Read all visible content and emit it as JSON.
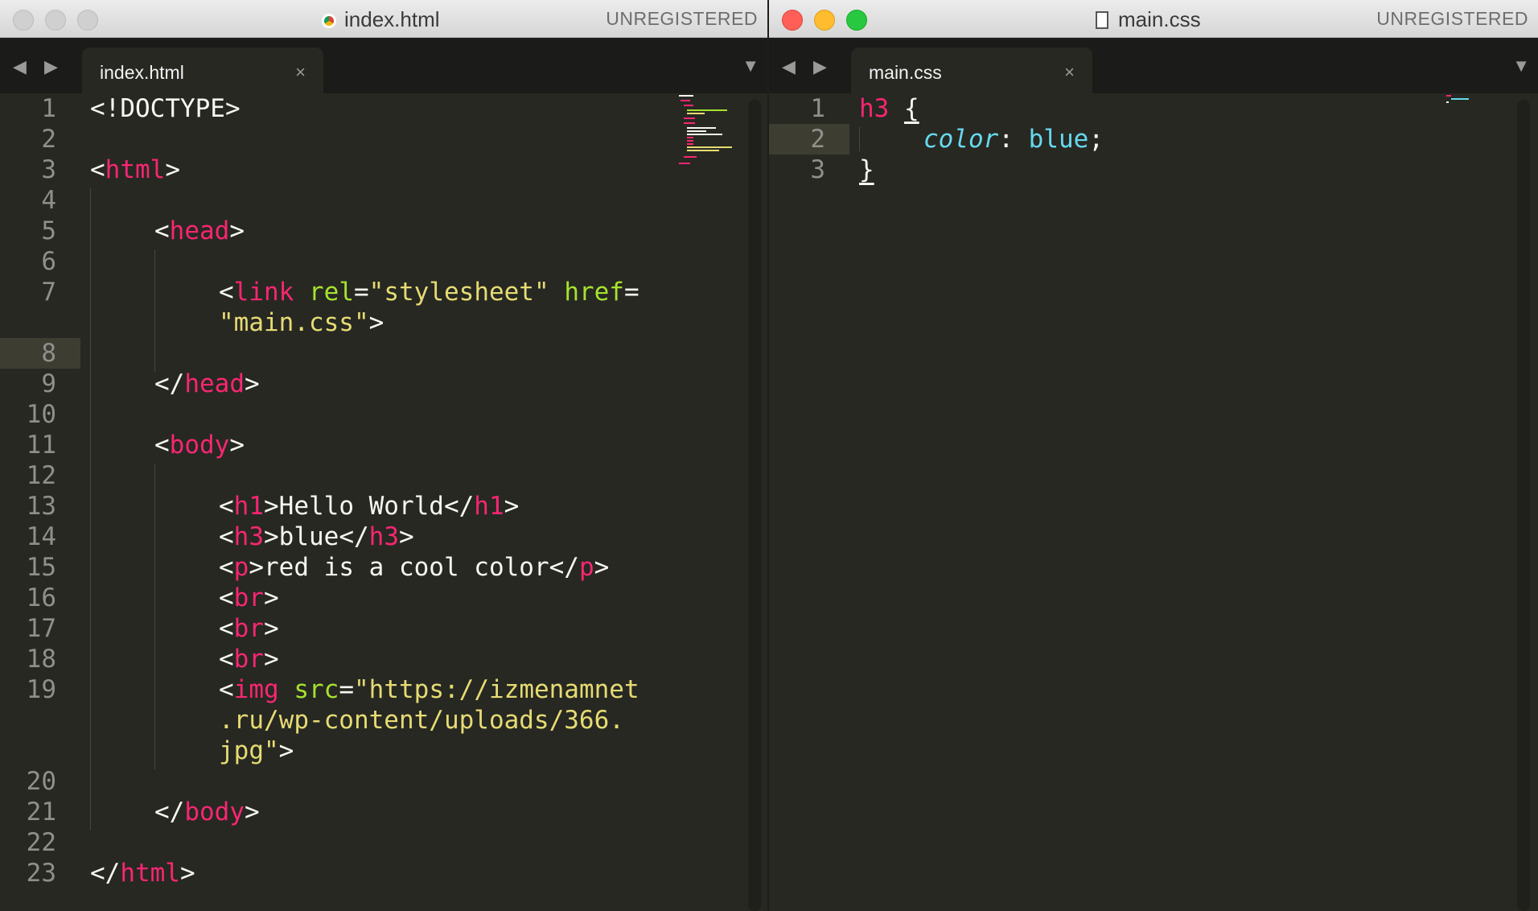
{
  "left_window": {
    "title": "index.html",
    "unregistered": "UNREGISTERED",
    "tab_label": "index.html",
    "tab_close": "×",
    "nav_arrows": "◀ ▶",
    "tab_menu": "▼",
    "highlighted_line": 8,
    "lines": [
      {
        "n": "1",
        "y": 0,
        "segs": [
          [
            "p",
            "<!DOCTYPE>"
          ]
        ]
      },
      {
        "n": "2",
        "y": 1,
        "segs": []
      },
      {
        "n": "3",
        "y": 2,
        "segs": [
          [
            "p",
            "<"
          ],
          [
            "t",
            "html"
          ],
          [
            "p",
            ">"
          ]
        ]
      },
      {
        "n": "4",
        "y": 3,
        "segs": []
      },
      {
        "n": "5",
        "y": 4,
        "indent": 1,
        "segs": [
          [
            "p",
            "<"
          ],
          [
            "t",
            "head"
          ],
          [
            "p",
            ">"
          ]
        ]
      },
      {
        "n": "6",
        "y": 5,
        "segs": []
      },
      {
        "n": "7",
        "y": 6,
        "indent": 2,
        "segs": [
          [
            "p",
            "<"
          ],
          [
            "t",
            "link"
          ],
          [
            "p",
            " "
          ],
          [
            "a",
            "rel"
          ],
          [
            "p",
            "="
          ],
          [
            "s",
            "\"stylesheet\""
          ],
          [
            "p",
            " "
          ],
          [
            "a",
            "href"
          ],
          [
            "p",
            "="
          ]
        ]
      },
      {
        "n": "",
        "y": 7,
        "indent": 2,
        "segs": [
          [
            "s",
            "\"main.css\""
          ],
          [
            "p",
            ">"
          ]
        ]
      },
      {
        "n": "8",
        "y": 8,
        "segs": []
      },
      {
        "n": "9",
        "y": 9,
        "indent": 1,
        "segs": [
          [
            "p",
            "</"
          ],
          [
            "t",
            "head"
          ],
          [
            "p",
            ">"
          ]
        ]
      },
      {
        "n": "10",
        "y": 10,
        "segs": []
      },
      {
        "n": "11",
        "y": 11,
        "indent": 1,
        "segs": [
          [
            "p",
            "<"
          ],
          [
            "t",
            "body"
          ],
          [
            "p",
            ">"
          ]
        ]
      },
      {
        "n": "12",
        "y": 12,
        "segs": []
      },
      {
        "n": "13",
        "y": 13,
        "indent": 2,
        "segs": [
          [
            "p",
            "<"
          ],
          [
            "t",
            "h1"
          ],
          [
            "p",
            ">Hello World</"
          ],
          [
            "t",
            "h1"
          ],
          [
            "p",
            ">"
          ]
        ]
      },
      {
        "n": "14",
        "y": 14,
        "indent": 2,
        "segs": [
          [
            "p",
            "<"
          ],
          [
            "t",
            "h3"
          ],
          [
            "p",
            ">blue</"
          ],
          [
            "t",
            "h3"
          ],
          [
            "p",
            ">"
          ]
        ]
      },
      {
        "n": "15",
        "y": 15,
        "indent": 2,
        "segs": [
          [
            "p",
            "<"
          ],
          [
            "t",
            "p"
          ],
          [
            "p",
            ">red is a cool color</"
          ],
          [
            "t",
            "p"
          ],
          [
            "p",
            ">"
          ]
        ]
      },
      {
        "n": "16",
        "y": 16,
        "indent": 2,
        "segs": [
          [
            "p",
            "<"
          ],
          [
            "t",
            "br"
          ],
          [
            "p",
            ">"
          ]
        ]
      },
      {
        "n": "17",
        "y": 17,
        "indent": 2,
        "segs": [
          [
            "p",
            "<"
          ],
          [
            "t",
            "br"
          ],
          [
            "p",
            ">"
          ]
        ]
      },
      {
        "n": "18",
        "y": 18,
        "indent": 2,
        "segs": [
          [
            "p",
            "<"
          ],
          [
            "t",
            "br"
          ],
          [
            "p",
            ">"
          ]
        ]
      },
      {
        "n": "19",
        "y": 19,
        "indent": 2,
        "segs": [
          [
            "p",
            "<"
          ],
          [
            "t",
            "img"
          ],
          [
            "p",
            " "
          ],
          [
            "a",
            "src"
          ],
          [
            "p",
            "="
          ],
          [
            "s",
            "\"https://izmenamnet"
          ]
        ]
      },
      {
        "n": "",
        "y": 20,
        "indent": 2,
        "segs": [
          [
            "s",
            ".ru/wp-content/uploads/366."
          ]
        ]
      },
      {
        "n": "",
        "y": 21,
        "indent": 2,
        "segs": [
          [
            "s",
            "jpg\""
          ],
          [
            "p",
            ">"
          ]
        ]
      },
      {
        "n": "20",
        "y": 22,
        "segs": []
      },
      {
        "n": "21",
        "y": 23,
        "indent": 1,
        "segs": [
          [
            "p",
            "</"
          ],
          [
            "t",
            "body"
          ],
          [
            "p",
            ">"
          ]
        ]
      },
      {
        "n": "22",
        "y": 24,
        "segs": []
      },
      {
        "n": "23",
        "y": 25,
        "segs": [
          [
            "p",
            "</"
          ],
          [
            "t",
            "html"
          ],
          [
            "p",
            ">"
          ]
        ]
      }
    ]
  },
  "right_window": {
    "title": "main.css",
    "unregistered": "UNREGISTERED",
    "tab_label": "main.css",
    "tab_close": "×",
    "nav_arrows": "◀ ▶",
    "tab_menu": "▼",
    "highlighted_line": 2,
    "lines": [
      {
        "n": "1",
        "y": 0,
        "segs": [
          [
            "t",
            "h3"
          ],
          [
            "p",
            " "
          ],
          [
            "b",
            "{"
          ]
        ]
      },
      {
        "n": "2",
        "y": 1,
        "indent": 1,
        "segs": [
          [
            "k",
            "color"
          ],
          [
            "p",
            ": "
          ],
          [
            "v",
            "blue"
          ],
          [
            "p",
            ";"
          ]
        ]
      },
      {
        "n": "3",
        "y": 2,
        "segs": [
          [
            "b",
            "}"
          ]
        ]
      }
    ]
  },
  "colors": {
    "editor_bg": "#272822",
    "tag": "#f92672",
    "attribute": "#a6e22e",
    "string": "#e6db74",
    "plain": "#f8f8f2",
    "keyword": "#66d9ef",
    "line_number": "#8f908a",
    "line_highlight": "#3e3d32",
    "traffic_red": "#ff5f57",
    "traffic_yellow": "#febc2e",
    "traffic_green": "#28c840",
    "traffic_inactive": "#d0d0d0"
  }
}
